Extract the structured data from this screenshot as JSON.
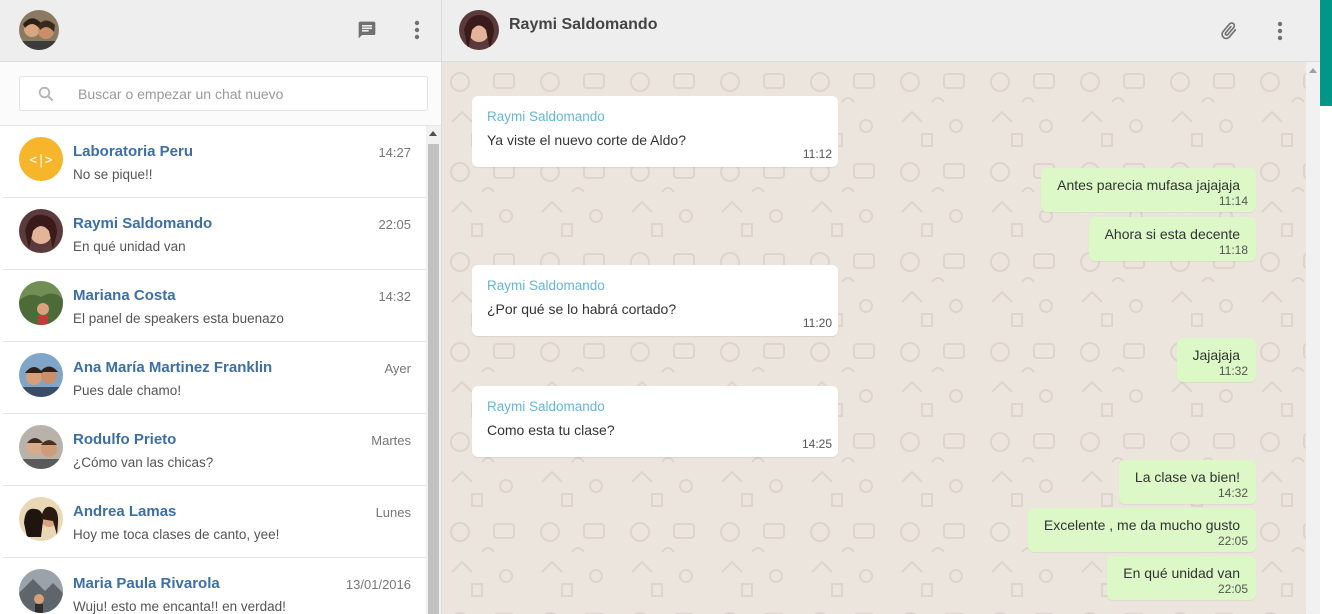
{
  "left_header": {
    "chat_icon": "chat-icon",
    "menu_icon": "more-vert-icon"
  },
  "search": {
    "placeholder": "Buscar o empezar un chat nuevo",
    "icon": "search-icon"
  },
  "chats": [
    {
      "name": "Laboratoria Peru",
      "time": "14:27",
      "preview": "No se pique!!"
    },
    {
      "name": "Raymi Saldomando",
      "time": "22:05",
      "preview": "En qué unidad van"
    },
    {
      "name": "Mariana Costa",
      "time": "14:32",
      "preview": "El panel de speakers esta buenazo"
    },
    {
      "name": "Ana María Martinez Franklin",
      "time": "Ayer",
      "preview": "Pues dale chamo!"
    },
    {
      "name": "Rodulfo Prieto",
      "time": "Martes",
      "preview": "¿Cómo van las chicas?"
    },
    {
      "name": "Andrea Lamas",
      "time": "Lunes",
      "preview": "Hoy me toca clases de canto, yee!"
    },
    {
      "name": "Maria Paula Rivarola",
      "time": "13/01/2016",
      "preview": "Wuju! esto me encanta!! en verdad!"
    }
  ],
  "conversation": {
    "contact_name": "Raymi Saldomando",
    "attach_icon": "paperclip-icon",
    "menu_icon": "more-vert-icon",
    "incoming": [
      {
        "sender": "Raymi Saldomando",
        "text": "Ya viste el nuevo corte de Aldo?",
        "time": "11:12"
      },
      {
        "sender": "Raymi Saldomando",
        "text": "¿Por qué se lo habrá cortado?",
        "time": "11:20"
      },
      {
        "sender": "Raymi Saldomando",
        "text": "Como esta tu clase?",
        "time": "14:25"
      }
    ],
    "outgoing": [
      {
        "text": "Antes parecia mufasa jajajaja",
        "time": "11:14"
      },
      {
        "text": "Ahora si esta decente",
        "time": "11:18"
      },
      {
        "text": "Jajajaja",
        "time": "11:32"
      },
      {
        "text": "La clase va bien!",
        "time": "14:32"
      },
      {
        "text": "Excelente , me da mucho gusto",
        "time": "22:05"
      },
      {
        "text": "En qué unidad van",
        "time": "22:05"
      }
    ]
  },
  "colors": {
    "accent": "#009688",
    "name_link": "#3b6fa6",
    "sender": "#63b6d9",
    "outgoing_bubble": "#dcf8c6",
    "chat_background": "#ece5dd"
  }
}
